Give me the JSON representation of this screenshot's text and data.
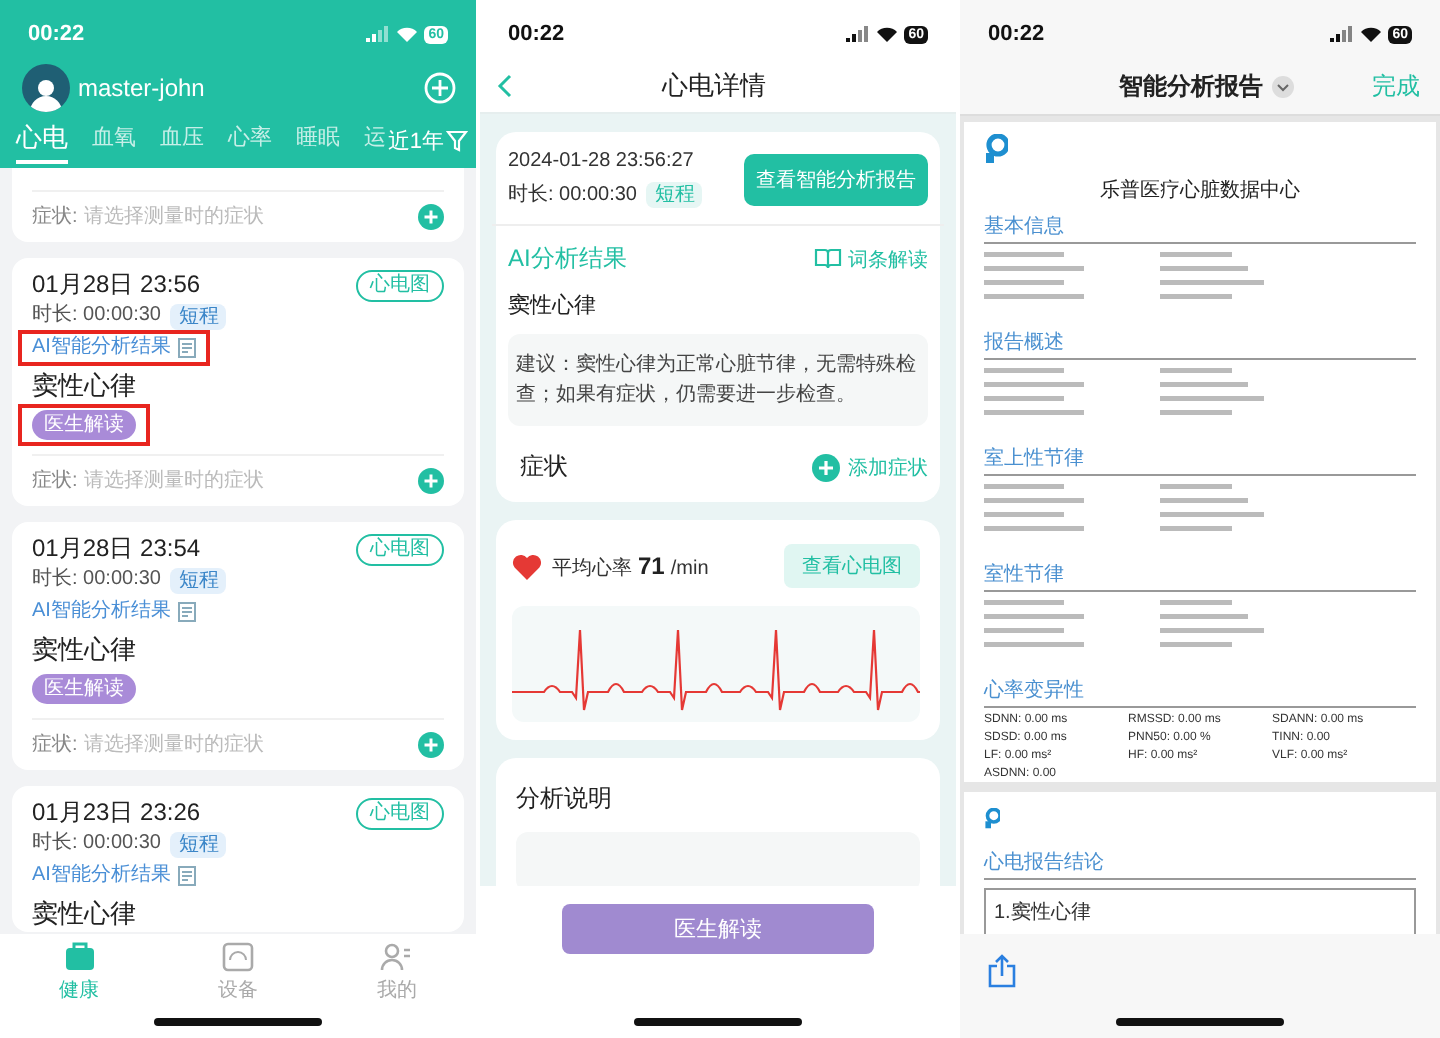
{
  "list_screen": {
    "status": {
      "time": "00:22",
      "battery": "60"
    },
    "user": "master-john",
    "tabs": [
      {
        "label": "心电",
        "selected": true
      },
      {
        "label": "血氧",
        "selected": false
      },
      {
        "label": "血压",
        "selected": false
      },
      {
        "label": "心率",
        "selected": false
      },
      {
        "label": "睡眠",
        "selected": false
      },
      {
        "label": "运",
        "selected": false
      }
    ],
    "filter": "近1年",
    "records": [
      {
        "kind": "partial",
        "symptom_label": "症状:",
        "symptom_placeholder": "请选择测量时的症状"
      },
      {
        "kind": "full",
        "highlighted": true,
        "datetime": "01月28日 23:56",
        "duration": "时长: 00:00:30",
        "badge": "短程",
        "ecg_button": "心电图",
        "ai_link": "AI智能分析结果",
        "result": "窦性心律",
        "doctor_button": "医生解读",
        "symptom_label": "症状:",
        "symptom_placeholder": "请选择测量时的症状"
      },
      {
        "kind": "full",
        "highlighted": false,
        "datetime": "01月28日 23:54",
        "duration": "时长: 00:00:30",
        "badge": "短程",
        "ecg_button": "心电图",
        "ai_link": "AI智能分析结果",
        "result": "窦性心律",
        "doctor_button": "医生解读",
        "symptom_label": "症状:",
        "symptom_placeholder": "请选择测量时的症状"
      },
      {
        "kind": "cut",
        "datetime": "01月23日 23:26",
        "duration": "时长: 00:00:30",
        "badge": "短程",
        "ecg_button": "心电图",
        "ai_link": "AI智能分析结果",
        "result": "窦性心律"
      }
    ],
    "tab_bar": [
      {
        "label": "健康",
        "selected": true
      },
      {
        "label": "设备",
        "selected": false
      },
      {
        "label": "我的",
        "selected": false
      }
    ]
  },
  "detail_screen": {
    "status": {
      "time": "00:22",
      "battery": "60"
    },
    "title": "心电详情",
    "datetime": "2024-01-28 23:56:27",
    "duration": "时长: 00:00:30",
    "badge": "短程",
    "report_button": "查看智能分析报告",
    "ai_title": "AI分析结果",
    "glossary_link": "词条解读",
    "result": "窦性心律",
    "advice": "建议：窦性心律为正常心脏节律，无需特殊检查；如果有症状，仍需要进一步检查。",
    "symptom_title": "症状",
    "add_symptom": "添加症状",
    "hr_label": "平均心率",
    "hr_value": "71",
    "hr_unit": "/min",
    "ecg_button": "查看心电图",
    "analysis_title": "分析说明",
    "bottom_button": "医生解读"
  },
  "report_screen": {
    "status": {
      "time": "00:22",
      "battery": "60"
    },
    "title": "智能分析报告",
    "done": "完成",
    "page_1": {
      "org": "乐普医疗心脏数据中心",
      "sections": [
        {
          "heading": "基本信息",
          "kind": "lines"
        },
        {
          "heading": "报告概述",
          "kind": "lines"
        },
        {
          "heading": "室上性节律",
          "kind": "lines"
        },
        {
          "heading": "室性节律",
          "kind": "lines"
        },
        {
          "heading": "心率变异性",
          "kind": "values",
          "items": [
            [
              "SDNN: 0.00 ms",
              "RMSSD: 0.00 ms",
              "SDANN: 0.00 ms"
            ],
            [
              "SDSD: 0.00 ms",
              "PNN50: 0.00 %",
              "TINN: 0.00"
            ],
            [
              "LF: 0.00 ms²",
              "HF: 0.00 ms²",
              "VLF: 0.00 ms²"
            ],
            [
              "ASDNN: 0.00"
            ]
          ]
        }
      ]
    },
    "page_2": {
      "heading": "心电报告结论",
      "conclusion": "1.窦性心律"
    }
  }
}
